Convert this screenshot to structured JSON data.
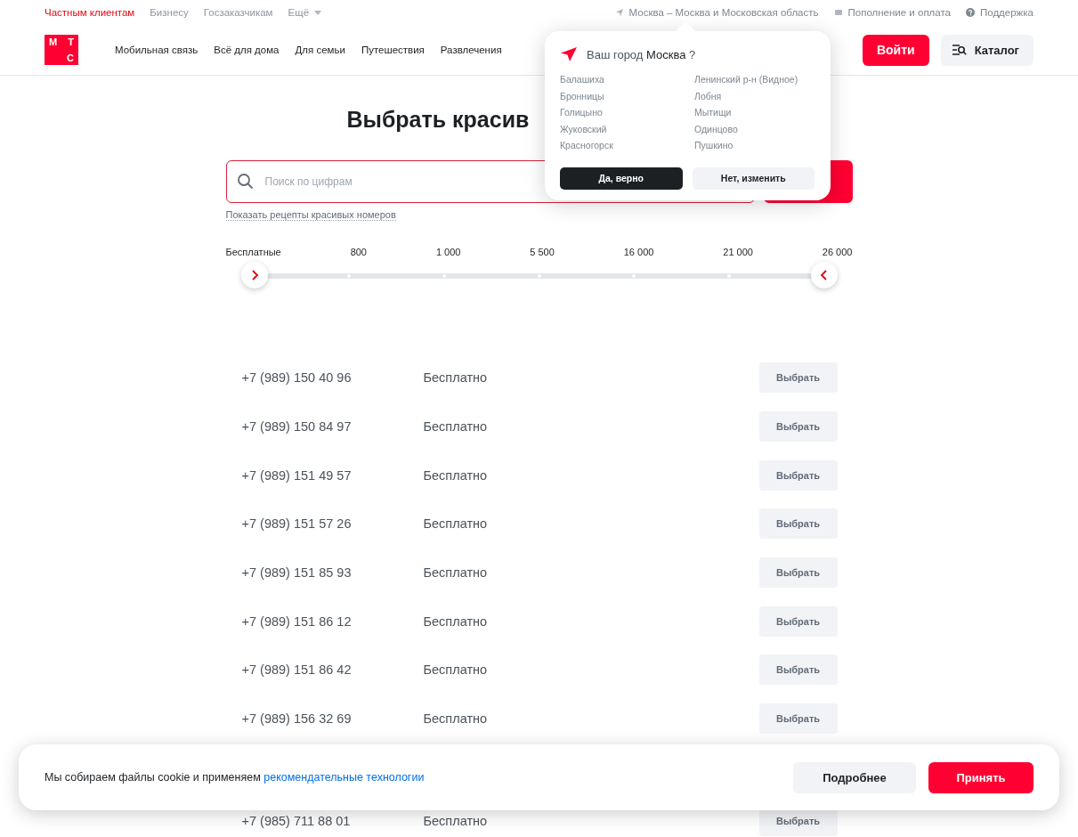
{
  "top_bar": {
    "segments": [
      {
        "label": "Частным клиентам",
        "selected": true
      },
      {
        "label": "Бизнесу",
        "selected": false
      },
      {
        "label": "Госзаказчикам",
        "selected": false
      },
      {
        "label": "Ещё",
        "selected": false,
        "kind": "dropdown"
      }
    ],
    "links": [
      {
        "label": "Москва – Москва и Московская область",
        "kind": "location"
      },
      {
        "label": "Пополнение и оплата",
        "kind": "card"
      },
      {
        "label": "Поддержка",
        "kind": "help"
      }
    ]
  },
  "logo": {
    "letters": [
      "М",
      "Т",
      "С"
    ]
  },
  "nav": {
    "items": [
      "Мобильная связь",
      "Всё для дома",
      "Для семьи",
      "Путешествия",
      "Развлечения"
    ],
    "login": "Войти",
    "catalog": "Каталог"
  },
  "city_popup": {
    "question_before": "Ваш город",
    "city": "Москва",
    "question_after": "?",
    "cities": [
      "Балашиха",
      "Бронницы",
      "Голицыно",
      "Жуковский",
      "Красногорск",
      "Ленинский р-н (Видное)",
      "Лобня",
      "Мытищи",
      "Одинцово",
      "Пушкино"
    ],
    "confirm": "Да, верно",
    "change": "Нет, изменить"
  },
  "title": "Выбрать красив",
  "search": {
    "placeholder": "Поиск по цифрам",
    "recipes_link": "Показать рецепты красивых номеров"
  },
  "price_filter": {
    "ticks": [
      "Бесплатные",
      "800",
      "1 000",
      "5 500",
      "16 000",
      "21 000",
      "26 000"
    ],
    "thumbs": [
      {
        "level": 0
      },
      {
        "level": 1
      }
    ]
  },
  "numbers": [
    {
      "number": "+7 (989) 150 40 96",
      "price": "Бесплатно",
      "action": "Выбрать"
    },
    {
      "number": "+7 (989) 150 84 97",
      "price": "Бесплатно",
      "action": "Выбрать"
    },
    {
      "number": "+7 (989) 151 49 57",
      "price": "Бесплатно",
      "action": "Выбрать"
    },
    {
      "number": "+7 (989) 151 57 26",
      "price": "Бесплатно",
      "action": "Выбрать"
    },
    {
      "number": "+7 (989) 151 85 93",
      "price": "Бесплатно",
      "action": "Выбрать"
    },
    {
      "number": "+7 (989) 151 86 12",
      "price": "Бесплатно",
      "action": "Выбрать"
    },
    {
      "number": "+7 (989) 151 86 42",
      "price": "Бесплатно",
      "action": "Выбрать"
    },
    {
      "number": "+7 (989) 156 32 69",
      "price": "Бесплатно",
      "action": "Выбрать"
    },
    {
      "number": "+7 (985) 711 88 01",
      "price": "Бесплатно",
      "action": "Выбрать"
    }
  ],
  "cookie_banner": {
    "text": "Мы собираем файлы cookie и применяем",
    "link": "рекомендательные технологии",
    "more": "Подробнее",
    "accept": "Принять"
  }
}
